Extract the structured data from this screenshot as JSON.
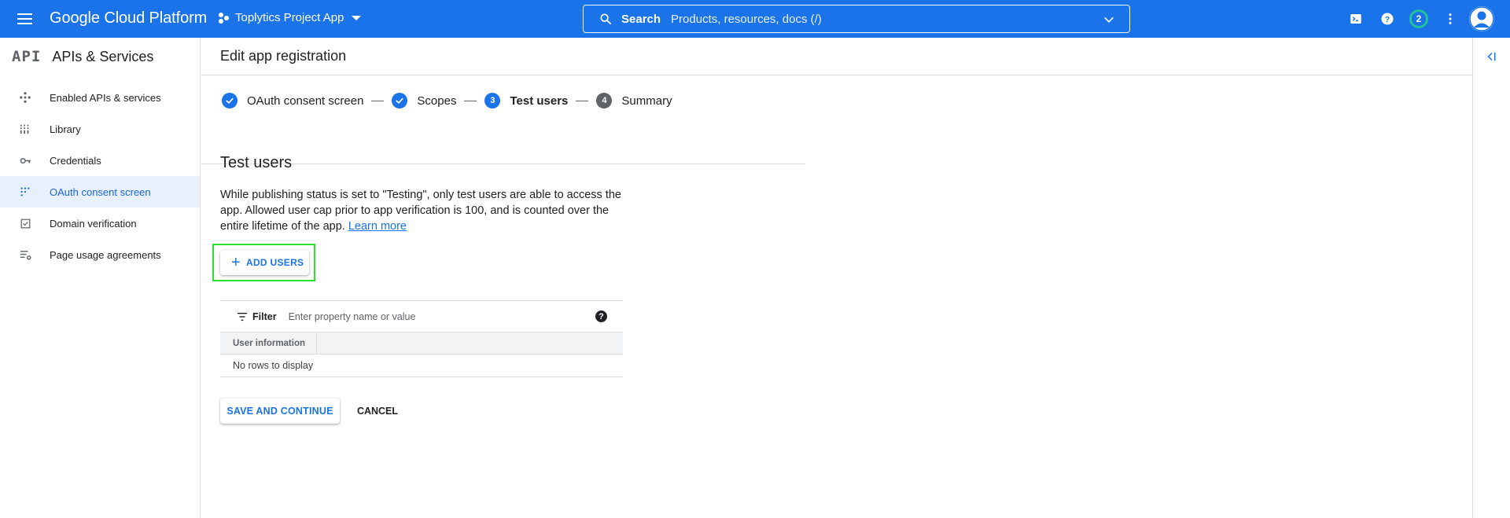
{
  "topbar": {
    "brand": "Google Cloud Platform",
    "project": "Toplytics Project App",
    "search_label": "Search",
    "search_placeholder": "Products, resources, docs (/)",
    "notification_count": "2"
  },
  "sidebar": {
    "logo": "API",
    "title": "APIs & Services",
    "items": [
      {
        "label": "Enabled APIs & services",
        "icon": "apis-icon"
      },
      {
        "label": "Library",
        "icon": "library-icon"
      },
      {
        "label": "Credentials",
        "icon": "key-icon"
      },
      {
        "label": "OAuth consent screen",
        "icon": "consent-icon",
        "active": true
      },
      {
        "label": "Domain verification",
        "icon": "checkbox-icon"
      },
      {
        "label": "Page usage agreements",
        "icon": "settings-list-icon"
      }
    ]
  },
  "page": {
    "title": "Edit app registration",
    "steps": [
      {
        "label": "OAuth consent screen",
        "state": "done"
      },
      {
        "label": "Scopes",
        "state": "done"
      },
      {
        "number": "3",
        "label": "Test users",
        "state": "current"
      },
      {
        "number": "4",
        "label": "Summary",
        "state": "todo"
      }
    ],
    "section_title": "Test users",
    "description": "While publishing status is set to \"Testing\", only test users are able to access the app. Allowed user cap prior to app verification is 100, and is counted over the entire lifetime of the app.",
    "learn_more": "Learn more",
    "add_users": "ADD USERS",
    "filter_label": "Filter",
    "filter_placeholder": "Enter property name or value",
    "help_glyph": "?",
    "table_header": "User information",
    "empty_text": "No rows to display",
    "save_continue": "SAVE AND CONTINUE",
    "cancel": "CANCEL"
  },
  "colors": {
    "accent": "#1a73e8",
    "active_bg": "#e8f0fe",
    "highlight": "#2ee02e"
  }
}
